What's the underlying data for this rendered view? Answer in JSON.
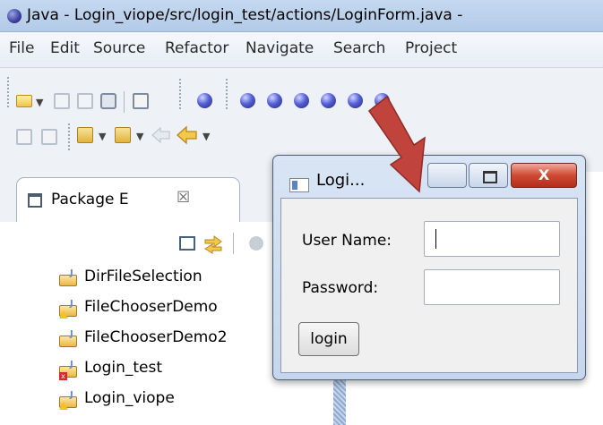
{
  "window": {
    "title": "Java - Login_viope/src/login_test/actions/LoginForm.java -"
  },
  "menu": [
    "File",
    "Edit",
    "Source",
    "Refactor",
    "Navigate",
    "Search",
    "Project"
  ],
  "package_explorer": {
    "tab_label": "Package E",
    "close_glyph": "☒",
    "projects": [
      {
        "label": "DirFileSelection",
        "marker": "none"
      },
      {
        "label": "FileChooserDemo",
        "marker": "warning"
      },
      {
        "label": "FileChooserDemo2",
        "marker": "none"
      },
      {
        "label": "Login_test",
        "marker": "error"
      },
      {
        "label": "Login_viope",
        "marker": "warning"
      }
    ]
  },
  "dialog": {
    "title": "Logi...",
    "close_label": "X",
    "username_label": "User Name:",
    "password_label": "Password:",
    "username_value": "",
    "password_value": "",
    "login_button": "login"
  },
  "colors": {
    "annotation_arrow": "#c0443c",
    "close_button": "#cf4a33"
  }
}
